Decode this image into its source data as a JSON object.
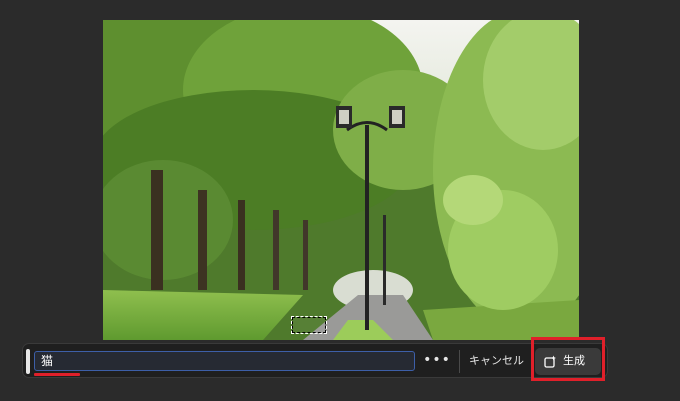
{
  "canvas": {
    "image_description_icon": "photo-icon"
  },
  "taskbar": {
    "prompt_value": "猫",
    "more_label": "•••",
    "cancel_label": "キャンセル",
    "generate_label": "生成",
    "generate_icon": "generate-sparkle-icon"
  },
  "colors": {
    "highlight": "#e0202a",
    "prompt_border": "#3d5fa8",
    "background": "#2b2b2b"
  }
}
